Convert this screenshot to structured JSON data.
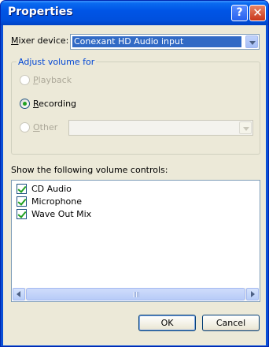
{
  "window": {
    "title": "Properties",
    "help_glyph": "?",
    "close_glyph": "✕"
  },
  "mixer": {
    "label_accel": "M",
    "label_rest": "ixer device:",
    "value": "Conexant HD Audio input"
  },
  "adjust_group": {
    "title": "Adjust volume for",
    "playback": {
      "accel": "P",
      "rest": "layback",
      "enabled": false,
      "checked": false
    },
    "recording": {
      "accel": "R",
      "rest": "ecording",
      "enabled": true,
      "checked": true
    },
    "other": {
      "accel": "O",
      "rest": "ther",
      "enabled": false,
      "checked": false,
      "value": ""
    }
  },
  "controls": {
    "label": "Show the following volume controls:",
    "items": [
      {
        "label": "CD Audio",
        "checked": true
      },
      {
        "label": "Microphone",
        "checked": true
      },
      {
        "label": "Wave Out Mix",
        "checked": true
      }
    ]
  },
  "buttons": {
    "ok": "OK",
    "cancel": "Cancel"
  },
  "colors": {
    "title_bar": "#0055e6",
    "dialog_face": "#ece9d8",
    "selection": "#316ac5",
    "group_title": "#0046d5",
    "check_green": "#21a121"
  }
}
